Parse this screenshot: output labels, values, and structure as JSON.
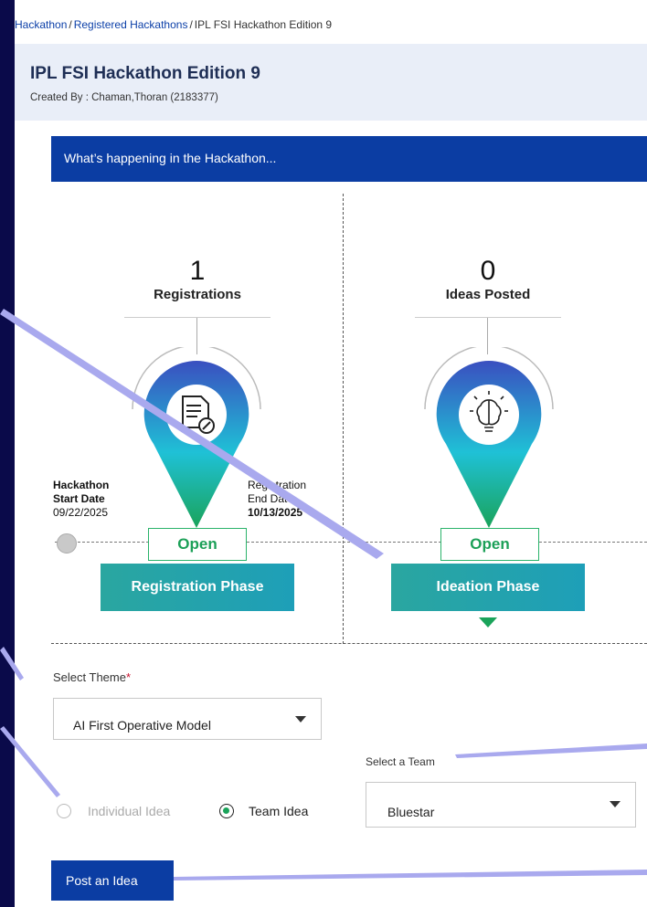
{
  "breadcrumb": {
    "items": [
      "Hackathon",
      "Registered Hackathons",
      "IPL FSI Hackathon Edition 9"
    ],
    "separator": "/"
  },
  "header": {
    "title": "IPL FSI Hackathon Edition 9",
    "created_by": "Created By : Chaman,Thoran (2183377)"
  },
  "section": {
    "title": "What’s happening in the Hackathon..."
  },
  "stats": {
    "registrations": {
      "count": "1",
      "label": "Registrations"
    },
    "ideas": {
      "count": "0",
      "label": "Ideas Posted"
    }
  },
  "timeline": {
    "start_label_line1": "Hackathon",
    "start_label_line2": "Start Date",
    "start_date": "09/22/2025",
    "reg_end_line1": "Registration",
    "reg_end_line2": "End Date",
    "reg_end_date": "10/13/2025"
  },
  "phases": [
    {
      "status": "Open",
      "name": "Registration Phase",
      "icon": "document-edit-icon"
    },
    {
      "status": "Open",
      "name": "Ideation Phase",
      "icon": "brain-icon"
    }
  ],
  "form": {
    "theme_label": "Select Theme",
    "required_marker": "*",
    "theme_value": "AI First Operative Model",
    "idea_type_options": [
      "Individual Idea",
      "Team Idea"
    ],
    "idea_type_selected": "Team Idea",
    "team_label": "Select a Team",
    "team_value": "Bluestar",
    "post_button": "Post an Idea"
  },
  "colors": {
    "brand_blue": "#0b3da3",
    "phase_teal": "#1e9fb8",
    "status_green": "#1ca058",
    "slide_background": "#0a0a4a"
  }
}
